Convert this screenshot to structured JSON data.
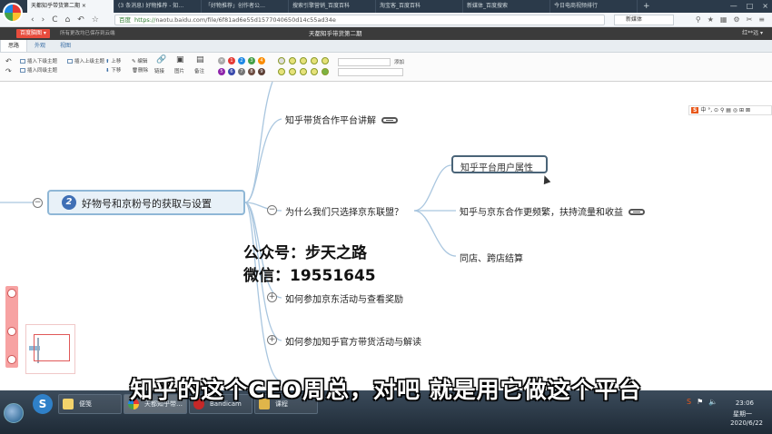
{
  "browser": {
    "tabs": [
      {
        "label": "天都知乎带货第二期 ×",
        "active": true
      },
      {
        "label": "(3 条消息) 好物推荐 - 知…"
      },
      {
        "label": "「好物推荐」创作者公…"
      },
      {
        "label": "搜索引擎营销_百度百科"
      },
      {
        "label": "淘宝客_百度百科"
      },
      {
        "label": "新媒体_百度搜索"
      },
      {
        "label": "今日电商视频排行"
      }
    ],
    "new_tab": "+",
    "window_controls": [
      "—",
      "□",
      "×"
    ],
    "nav": {
      "back": "‹",
      "forward": "›",
      "reload": "C",
      "home": "⌂",
      "restore": "↶",
      "star": "☆"
    },
    "url": {
      "secure_label": "百度",
      "scheme": "https://",
      "host_path": "naotu.baidu.com/file/6f81ad6e55d1577040650d14c55ad34e"
    },
    "search_box": "新媒体",
    "toolbar_icons": [
      "search-icon",
      "star-icon",
      "grid-icon",
      "settings-icon",
      "scissors-icon",
      "menu-icon"
    ]
  },
  "app": {
    "brand": "百度脑图 ▾",
    "save_status": "所有更改均已保存到云端",
    "doc_title": "天都知乎带货第二期",
    "user": "红**远 ▾"
  },
  "menu_tabs": [
    "思路",
    "外观",
    "视图"
  ],
  "toolbar": {
    "undo": "↶",
    "redo": "↷",
    "insert_child": "插入下级主题",
    "insert_parent": "插入上级主题",
    "insert_sibling": "插入同级主题",
    "move_up": "上移",
    "move_down": "下移",
    "edit": "编辑",
    "delete": "删除",
    "link": "链接",
    "image": "图片",
    "note": "备注",
    "priorities": [
      "×",
      "1",
      "2",
      "3",
      "4",
      "5",
      "6",
      "7",
      "8",
      "9"
    ],
    "font_add": "添加",
    "font_placeholder": ""
  },
  "mindmap": {
    "root": {
      "number": "2",
      "text": "好物号和京粉号的获取与设置"
    },
    "branches": [
      {
        "text": "知乎带货合作平台讲解",
        "has_link": true
      },
      {
        "text": "为什么我们只选择京东联盟？",
        "expanded": true,
        "children": [
          {
            "text": "知乎平台用户属性",
            "selected": true
          },
          {
            "text": "知乎与京东合作更频繁，扶持流量和收益",
            "has_link": true
          },
          {
            "text": "同店、跨店结算"
          }
        ]
      },
      {
        "text": "如何参加京东活动与查看奖励",
        "collapsed": true
      },
      {
        "text": "如何参加知乎官方带货活动与解读",
        "collapsed": true
      }
    ],
    "watermark_line1": "公众号：步天之路",
    "watermark_line2": "微信：19551645"
  },
  "subtitle": "知乎的这个CEO周总，对吧 就是用它做这个平台",
  "ime_bar": "中 °, ⊙ ⚲ ▤ ◎ ⊞ ⊠",
  "taskbar": {
    "apps": [
      {
        "label": "便笺",
        "color": "#f3d36b"
      },
      {
        "label": "天都知乎带…",
        "color": "#e53935",
        "active": true
      },
      {
        "label": "Bandicam",
        "color": "#c62828"
      },
      {
        "label": "课程",
        "color": "#e0b54a"
      }
    ],
    "time": "23:06",
    "weekday": "星期一",
    "date": "2020/6/22"
  }
}
